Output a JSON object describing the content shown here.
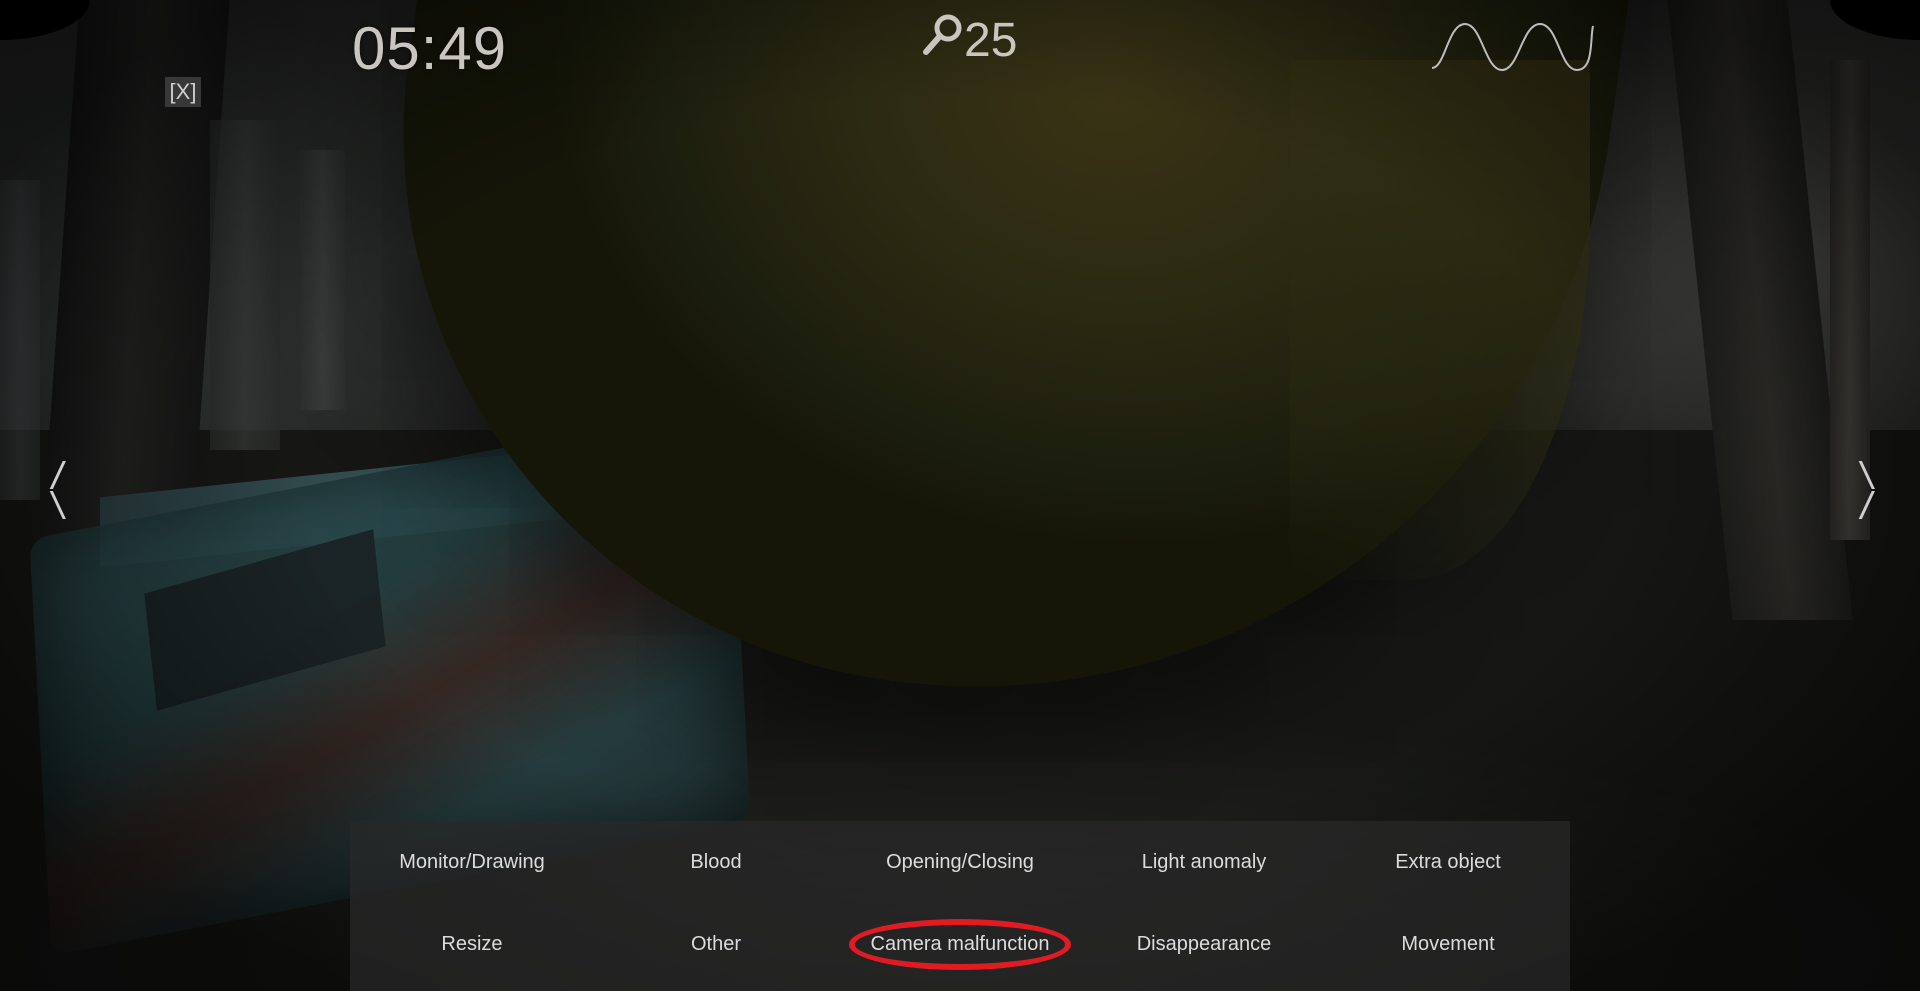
{
  "hud": {
    "timer": "05:49",
    "close_label": "[X]",
    "evidence_count": "25",
    "left_arrow_top": "/",
    "left_arrow_bottom": "\\",
    "right_arrow_top": "\\",
    "right_arrow_bottom": "/"
  },
  "icons": {
    "evidence": "magnifier-icon",
    "signal": "sine-wave-icon"
  },
  "anomaly_panel": {
    "categories": [
      "Monitor/Drawing",
      "Blood",
      "Opening/Closing",
      "Light anomaly",
      "Extra object",
      "Resize",
      "Other",
      "Camera malfunction",
      "Disappearance",
      "Movement"
    ],
    "selected": "Camera malfunction",
    "highlight_color": "#e01b22"
  }
}
